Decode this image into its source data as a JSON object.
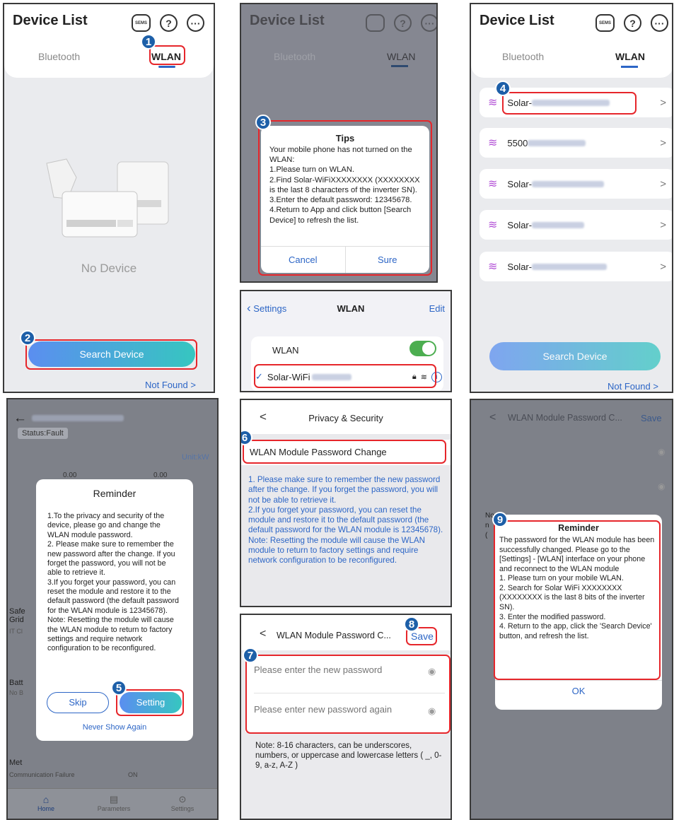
{
  "colors": {
    "accent": "#2d66c6",
    "gradient_start": "#5b8ef0",
    "gradient_end": "#36c6c0",
    "highlight": "#e6262b",
    "badge": "#1d5fa8",
    "wifi": "#b24fd6"
  },
  "badges": [
    "1",
    "2",
    "3",
    "4",
    "5",
    "6",
    "7",
    "8",
    "9"
  ],
  "p1": {
    "title": "Device List",
    "cloud_text": "SEMS",
    "help": "?",
    "more": "···",
    "tab_bluetooth": "Bluetooth",
    "tab_wlan": "WLAN",
    "empty": "No Device",
    "search_button": "Search Device",
    "not_found": "Not Found >"
  },
  "p2": {
    "title": "Device List",
    "tab_bluetooth": "Bluetooth",
    "tab_wlan": "WLAN",
    "tips_title": "Tips",
    "tips_body": "Your mobile phone has not turned on the WLAN:\n1.Please turn on WLAN.\n2.Find Solar-WiFiXXXXXXXX (XXXXXXXX is the last 8 characters of the inverter SN).\n3.Enter the default password: 12345678.\n4.Return to App and click button [Search Device] to refresh the list.",
    "cancel": "Cancel",
    "sure": "Sure"
  },
  "p3": {
    "title": "Device List",
    "tab_bluetooth": "Bluetooth",
    "tab_wlan": "WLAN",
    "devices": [
      "Solar-",
      "5500",
      "Solar-",
      "Solar-",
      "Solar-"
    ],
    "search_button": "Search Device",
    "not_found": "Not Found >"
  },
  "p4": {
    "back": "Settings",
    "title": "WLAN",
    "edit": "Edit",
    "wlan_label": "WLAN",
    "network": "Solar-WiFi"
  },
  "p5": {
    "status": "Status:Fault",
    "unit": "Unit:kW",
    "v1": "0.00",
    "v2": "0.00",
    "bg_safety": "Safe",
    "bg_grid": "Grid",
    "bg_it": "IT Cl",
    "bg_batt": "Batt",
    "bg_nob": "No B",
    "bg_met": "Met",
    "bg_comm": "Communication Failure",
    "bg_on": "ON",
    "nav_home": "Home",
    "nav_params": "Parameters",
    "nav_settings": "Settings",
    "reminder_title": "Reminder",
    "reminder_body": "1.To the privacy and security of the device, please go and change the WLAN module password.\n2. Please make sure to remember the new password after the change. If you forget the password, you will not be able to retrieve it.\n3.If you forget your password, you can reset the module and restore it to the default password (the default password for the WLAN module is 12345678).\nNote: Resetting the module will cause the WLAN module to return to factory settings and require network configuration to be reconfigured.",
    "skip": "Skip",
    "setting": "Setting",
    "never": "Never Show Again"
  },
  "p6": {
    "back": "<",
    "title": "Privacy & Security",
    "item": "WLAN Module Password Change",
    "note": "1. Please make sure to remember the new password after the change. If you forget the password, you will not be able to retrieve it.\n2.If you forget your password, you can reset the module and restore it to the default password (the default password for the WLAN module is 12345678).\nNote: Resetting the module will cause the WLAN module to return to factory settings and require network configuration to be reconfigured."
  },
  "p7": {
    "back": "<",
    "title": "WLAN Module Password C...",
    "save": "Save",
    "placeholder1": "Please enter the new password",
    "placeholder2": "Please enter new password again",
    "note": "Note: 8-16 characters, can be underscores, numbers, or uppercase and lowercase letters ( _, 0-9, a-z, A-Z )"
  },
  "p8": {
    "back": "<",
    "title": "WLAN Module Password C...",
    "save": "Save",
    "bg_no": "No",
    "bg_n": "n",
    "bg_p": "(",
    "reminder_title": "Reminder",
    "reminder_body": "The password for the WLAN module has been successfully changed. Please go to the [Settings] - [WLAN] interface on your phone and reconnect to the WLAN module\n1. Please turn on your mobile WLAN.\n2. Search for Solar WiFi XXXXXXXX (XXXXXXXX is the last 8 bits of the inverter SN).\n3. Enter the modified password.\n4. Return to the app, click the 'Search Device' button, and refresh the list.",
    "ok": "OK"
  }
}
